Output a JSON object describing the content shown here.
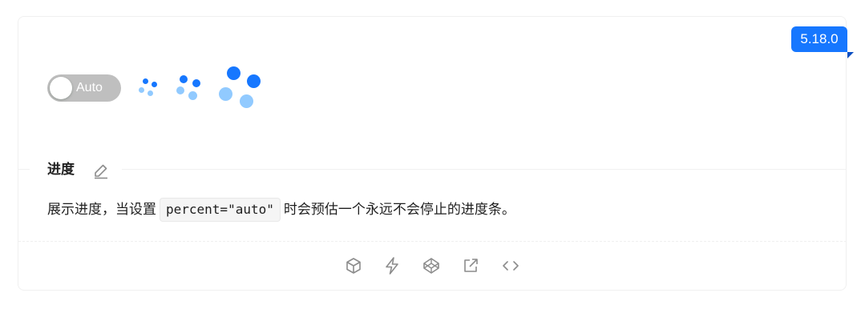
{
  "version": "5.18.0",
  "switch": {
    "label": "Auto",
    "checked": false
  },
  "section": {
    "title": "进度",
    "desc_before": "展示进度，当设置",
    "code": "percent=\"auto\"",
    "desc_after": "时会预估一个永远不会停止的进度条。"
  },
  "colors": {
    "primary": "#1677ff",
    "primary_light": "#91caff",
    "switch_off": "#bfbfbf"
  },
  "actions": [
    {
      "icon": "codesandbox-icon"
    },
    {
      "icon": "stackblitz-icon"
    },
    {
      "icon": "codepen-icon"
    },
    {
      "icon": "external-link-icon"
    },
    {
      "icon": "code-icon"
    }
  ]
}
